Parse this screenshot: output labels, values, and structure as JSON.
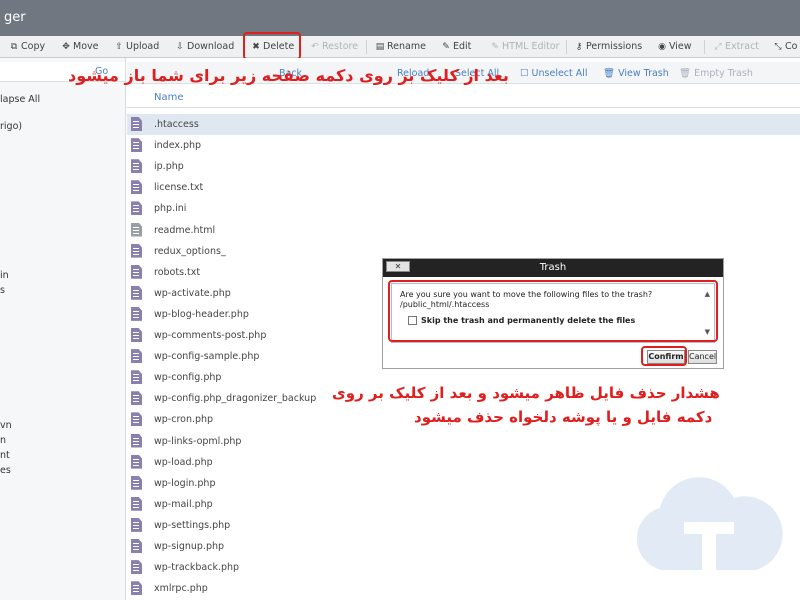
{
  "app": {
    "title": "ger"
  },
  "toolbar": {
    "copy": "Copy",
    "move": "Move",
    "upload": "Upload",
    "download": "Download",
    "delete": "Delete",
    "restore": "Restore",
    "rename": "Rename",
    "edit": "Edit",
    "html_editor": "HTML Editor",
    "permissions": "Permissions",
    "view": "View",
    "extract": "Extract",
    "compress": "Co"
  },
  "left": {
    "collapse": "lapse All",
    "go": "Go",
    "root": "rigo)",
    "partials": [
      "in",
      "s",
      "vn",
      "n",
      "nt",
      "es"
    ]
  },
  "subbar": {
    "back": "Back",
    "reload": "Reload",
    "select_all": "Select All",
    "unselect_all": "Unselect All",
    "view_trash": "View Trash",
    "empty_trash": "Empty Trash"
  },
  "columns": {
    "name": "Name"
  },
  "files": [
    ".htaccess",
    "index.php",
    "ip.php",
    "license.txt",
    "php.ini",
    "readme.html",
    "redux_options_",
    "robots.txt",
    "wp-activate.php",
    "wp-blog-header.php",
    "wp-comments-post.php",
    "wp-config-sample.php",
    "wp-config.php",
    "wp-config.php_dragonizer_backup",
    "wp-cron.php",
    "wp-links-opml.php",
    "wp-load.php",
    "wp-login.php",
    "wp-mail.php",
    "wp-settings.php",
    "wp-signup.php",
    "wp-trackback.php",
    "xmlrpc.php"
  ],
  "annotations": {
    "top": "بعد از کلیک بر روی دکمه صفحه زیر برای شما باز میشود",
    "bottom_line1": "هشدار حذف فایل ظاهر میشود و بعد از کلیک بر روی",
    "bottom_line2": "دکمه فایل و یا پوشه دلخواه حذف میشود"
  },
  "dialog": {
    "title": "Trash",
    "close": "✕",
    "message": "Are you sure you want to move the following files to the trash?",
    "path": "/public_html/.htaccess",
    "checkbox_label": "Skip the trash and permanently delete the files",
    "confirm": "Confirm",
    "cancel": "Cancel"
  },
  "colors": {
    "accent": "#4a7fc0",
    "highlight": "#e01e1e",
    "titlebar": "#707780"
  },
  "icons": {
    "copy": "copy-icon",
    "move": "move-icon",
    "upload": "upload-icon",
    "download": "download-icon",
    "delete": "close-icon",
    "restore": "undo-icon",
    "rename": "rename-icon",
    "edit": "pencil-icon",
    "permissions": "key-icon",
    "view": "eye-icon",
    "extract": "extract-icon",
    "compress": "compress-icon"
  }
}
